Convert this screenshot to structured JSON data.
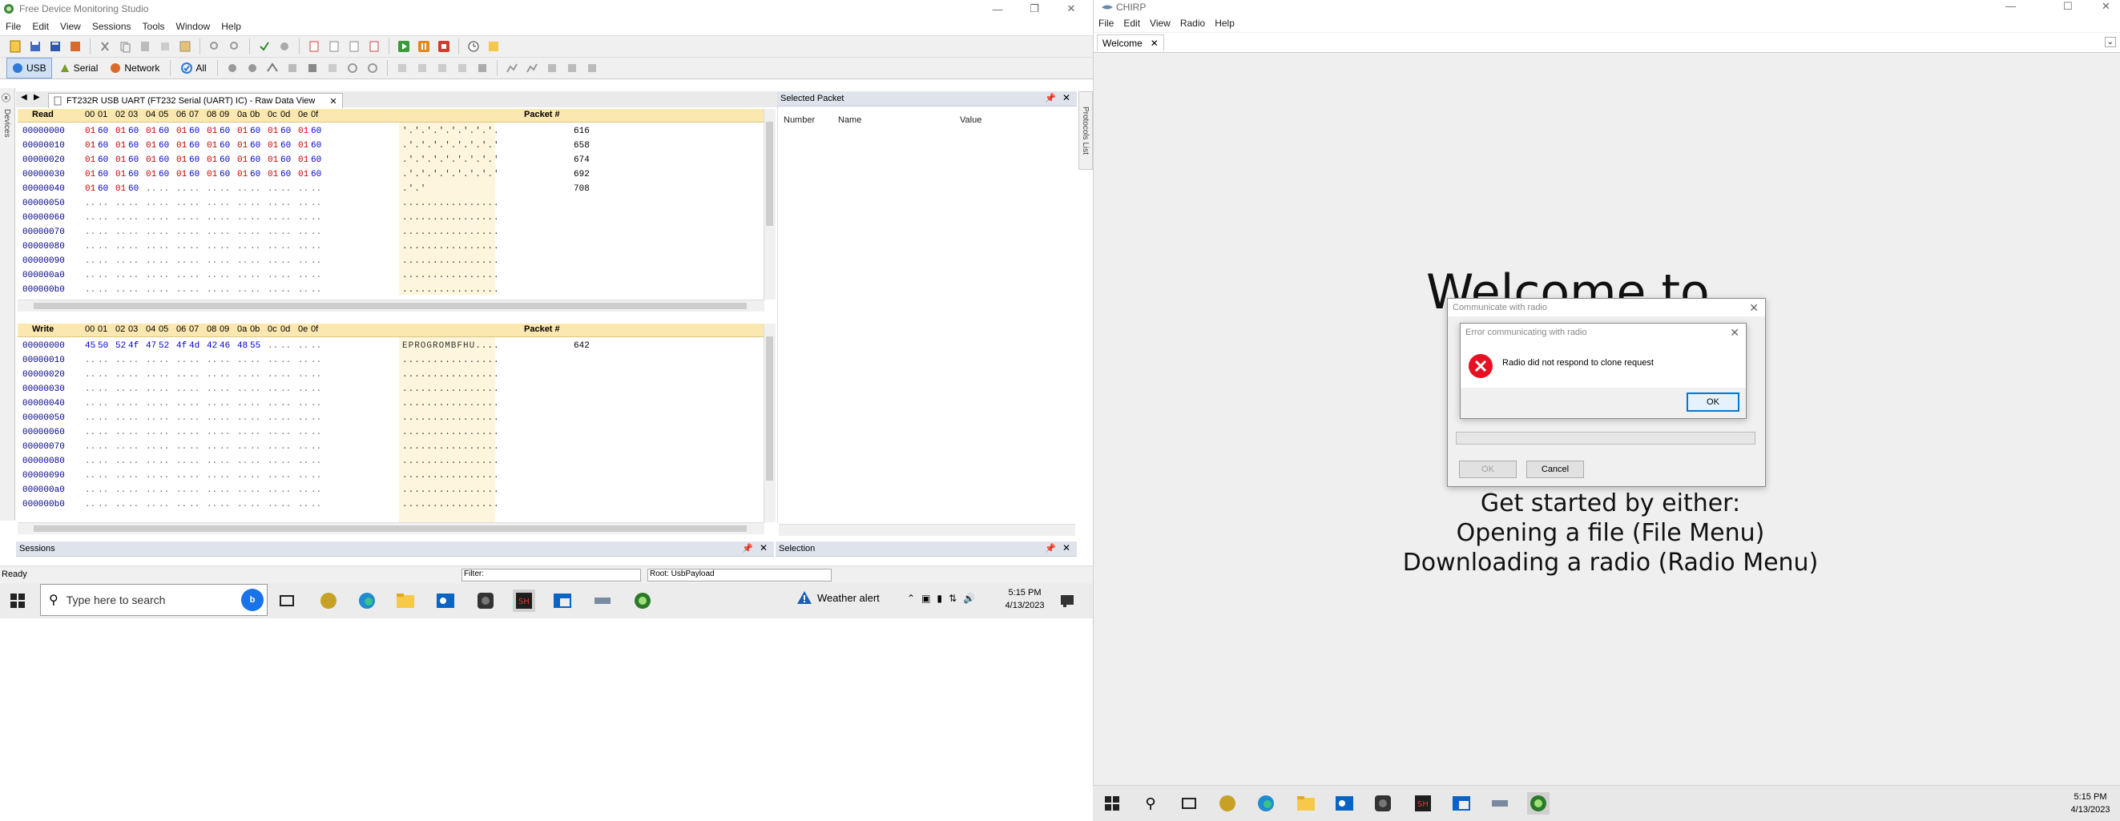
{
  "fdms": {
    "title": "Free Device Monitoring Studio",
    "menu": [
      "File",
      "Edit",
      "View",
      "Sessions",
      "Tools",
      "Window",
      "Help"
    ],
    "filter_tabs": [
      "USB",
      "Serial",
      "Network",
      "All"
    ],
    "side_labels": {
      "devices": "Devices",
      "protocols": "Protocols List"
    },
    "doc_tab": "FT232R USB UART (FT232 Serial (UART) IC) - Raw Data View",
    "read_pane": {
      "label": "Read",
      "columns": [
        "00",
        "01",
        "02",
        "03",
        "04",
        "05",
        "06",
        "07",
        "08",
        "09",
        "0a",
        "0b",
        "0c",
        "0d",
        "0e",
        "0f"
      ],
      "packet_header": "Packet #",
      "rows": [
        {
          "offset": "00000000",
          "bytes": [
            "01",
            "60",
            "01",
            "60",
            "01",
            "60",
            "01",
            "60",
            "01",
            "60",
            "01",
            "60",
            "01",
            "60",
            "01",
            "60"
          ],
          "ascii": "'.'.'.'.'.'.'.'.",
          "packet": "616"
        },
        {
          "offset": "00000010",
          "bytes": [
            "01",
            "60",
            "01",
            "60",
            "01",
            "60",
            "01",
            "60",
            "01",
            "60",
            "01",
            "60",
            "01",
            "60",
            "01",
            "60"
          ],
          "ascii": ".'.'.'.'.'.'.'.'",
          "packet": "658"
        },
        {
          "offset": "00000020",
          "bytes": [
            "01",
            "60",
            "01",
            "60",
            "01",
            "60",
            "01",
            "60",
            "01",
            "60",
            "01",
            "60",
            "01",
            "60",
            "01",
            "60"
          ],
          "ascii": ".'.'.'.'.'.'.'.'",
          "packet": "674"
        },
        {
          "offset": "00000030",
          "bytes": [
            "01",
            "60",
            "01",
            "60",
            "01",
            "60",
            "01",
            "60",
            "01",
            "60",
            "01",
            "60",
            "01",
            "60",
            "01",
            "60"
          ],
          "ascii": ".'.'.'.'.'.'.'.'",
          "packet": "692"
        },
        {
          "offset": "00000040",
          "bytes": [
            "01",
            "60",
            "01",
            "60"
          ],
          "ascii": ".'.'",
          "packet": "708"
        },
        {
          "offset": "00000050",
          "bytes": [],
          "ascii": "",
          "packet": ""
        },
        {
          "offset": "00000060",
          "bytes": [],
          "ascii": "",
          "packet": ""
        },
        {
          "offset": "00000070",
          "bytes": [],
          "ascii": "",
          "packet": ""
        },
        {
          "offset": "00000080",
          "bytes": [],
          "ascii": "",
          "packet": ""
        },
        {
          "offset": "00000090",
          "bytes": [],
          "ascii": "",
          "packet": ""
        },
        {
          "offset": "000000a0",
          "bytes": [],
          "ascii": "",
          "packet": ""
        },
        {
          "offset": "000000b0",
          "bytes": [],
          "ascii": "",
          "packet": ""
        }
      ]
    },
    "write_pane": {
      "label": "Write",
      "columns": [
        "00",
        "01",
        "02",
        "03",
        "04",
        "05",
        "06",
        "07",
        "08",
        "09",
        "0a",
        "0b",
        "0c",
        "0d",
        "0e",
        "0f"
      ],
      "packet_header": "Packet #",
      "rows": [
        {
          "offset": "00000000",
          "bytes": [
            "45",
            "50",
            "52",
            "4f",
            "47",
            "52",
            "4f",
            "4d",
            "42",
            "46",
            "48",
            "55"
          ],
          "ascii": "EPROGROMBFHU....",
          "packet": "642"
        },
        {
          "offset": "00000010",
          "bytes": [],
          "ascii": "",
          "packet": ""
        },
        {
          "offset": "00000020",
          "bytes": [],
          "ascii": "",
          "packet": ""
        },
        {
          "offset": "00000030",
          "bytes": [],
          "ascii": "",
          "packet": ""
        },
        {
          "offset": "00000040",
          "bytes": [],
          "ascii": "",
          "packet": ""
        },
        {
          "offset": "00000050",
          "bytes": [],
          "ascii": "",
          "packet": ""
        },
        {
          "offset": "00000060",
          "bytes": [],
          "ascii": "",
          "packet": ""
        },
        {
          "offset": "00000070",
          "bytes": [],
          "ascii": "",
          "packet": ""
        },
        {
          "offset": "00000080",
          "bytes": [],
          "ascii": "",
          "packet": ""
        },
        {
          "offset": "00000090",
          "bytes": [],
          "ascii": "",
          "packet": ""
        },
        {
          "offset": "000000a0",
          "bytes": [],
          "ascii": "",
          "packet": ""
        },
        {
          "offset": "000000b0",
          "bytes": [],
          "ascii": "",
          "packet": ""
        }
      ]
    },
    "selected_packet": {
      "title": "Selected Packet",
      "columns": [
        "Number",
        "Name",
        "Value"
      ]
    },
    "sessions_title": "Sessions",
    "selection_title": "Selection",
    "status": "Ready",
    "filter_label": "Filter:",
    "root_label": "Root: UsbPayload"
  },
  "taskbar_left": {
    "search_placeholder": "Type here to search",
    "weather": "Weather alert",
    "time": "5:15 PM",
    "date": "4/13/2023"
  },
  "chirp": {
    "title": "CHIRP",
    "menu": [
      "File",
      "Edit",
      "View",
      "Radio",
      "Help"
    ],
    "tab": "Welcome",
    "welcome_heading": "Welcome to",
    "welcome_lines": [
      "Get started by either:",
      "Opening a file (File Menu)",
      "Downloading a radio (Radio Menu)"
    ],
    "comm_dialog": {
      "title": "Communicate with radio",
      "ok": "OK",
      "cancel": "Cancel"
    },
    "error_dialog": {
      "title": "Error communicating with radio",
      "message": "Radio did not respond to clone request",
      "ok": "OK"
    }
  },
  "taskbar_right": {
    "time": "5:15 PM",
    "date": "4/13/2023"
  },
  "colors": {
    "hex_red": "#d00000",
    "hex_blue": "#0000d0",
    "header_yellow": "#fbe7b0",
    "error_red": "#e81123",
    "accent_blue": "#0078d7"
  }
}
